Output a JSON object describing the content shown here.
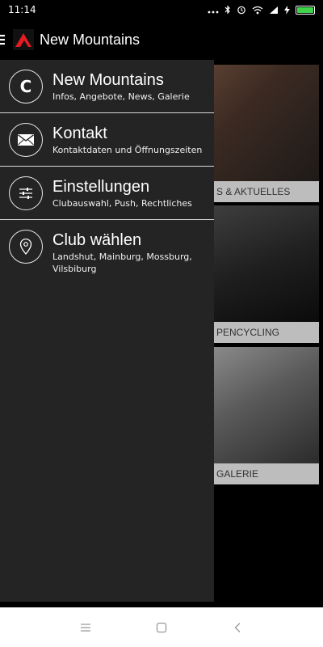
{
  "status_bar": {
    "time": "11:14",
    "icons": [
      "dots-icon",
      "bluetooth-icon",
      "alarm-icon",
      "wifi-icon",
      "signal-icon",
      "charging-icon",
      "battery-icon"
    ],
    "battery_level": 1.0,
    "battery_color": "#3fd24a"
  },
  "app_bar": {
    "title": "New Mountains",
    "logo_color": "#e31b23"
  },
  "drawer": {
    "items": [
      {
        "icon_letter": "C",
        "title": "New Mountains",
        "subtitle": "Infos, Angebote, News, Galerie"
      },
      {
        "title": "Kontakt",
        "subtitle": "Kontaktdaten und Öffnungszeiten"
      },
      {
        "title": "Einstellungen",
        "subtitle": "Clubauswahl, Push, Rechtliches"
      },
      {
        "title": "Club wählen",
        "subtitle": "Landshut, Mainburg, Mossburg, Vilsbiburg"
      }
    ]
  },
  "content": {
    "cards": [
      {
        "label": "S & AKTUELLES"
      },
      {
        "label": "PENCYCLING"
      },
      {
        "label": "GALERIE"
      }
    ]
  }
}
